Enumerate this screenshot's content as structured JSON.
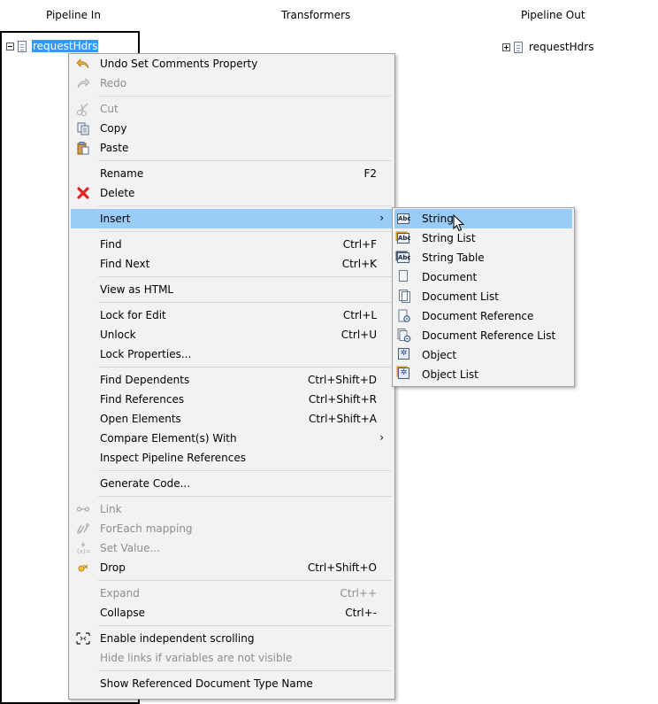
{
  "headers": {
    "pipeline_in": "Pipeline In",
    "transformers": "Transformers",
    "pipeline_out": "Pipeline Out"
  },
  "pipeline_in": {
    "node_label": "requestHdrs"
  },
  "pipeline_out": {
    "node_label": "requestHdrs"
  },
  "context_menu": {
    "undo": "Undo Set Comments Property",
    "redo": "Redo",
    "cut": "Cut",
    "copy": "Copy",
    "paste": "Paste",
    "rename": "Rename",
    "rename_shortcut": "F2",
    "delete": "Delete",
    "insert": "Insert",
    "find": "Find",
    "find_shortcut": "Ctrl+F",
    "find_next": "Find Next",
    "find_next_shortcut": "Ctrl+K",
    "view_as_html": "View as HTML",
    "lock_for_edit": "Lock for Edit",
    "lock_for_edit_shortcut": "Ctrl+L",
    "unlock": "Unlock",
    "unlock_shortcut": "Ctrl+U",
    "lock_properties": "Lock Properties...",
    "find_dependents": "Find Dependents",
    "find_dependents_shortcut": "Ctrl+Shift+D",
    "find_references": "Find References",
    "find_references_shortcut": "Ctrl+Shift+R",
    "open_elements": "Open Elements",
    "open_elements_shortcut": "Ctrl+Shift+A",
    "compare_elements": "Compare Element(s) With",
    "inspect_pipeline_refs": "Inspect Pipeline References",
    "generate_code": "Generate Code...",
    "link": "Link",
    "foreach_mapping": "ForEach mapping",
    "set_value": "Set Value...",
    "drop": "Drop",
    "drop_shortcut": "Ctrl+Shift+O",
    "expand": "Expand",
    "expand_shortcut": "Ctrl++",
    "collapse": "Collapse",
    "collapse_shortcut": "Ctrl+-",
    "enable_independent_scrolling": "Enable independent scrolling",
    "hide_links": "Hide links if variables are not visible",
    "show_referenced_doc": "Show Referenced Document Type Name",
    "submenu_arrow": "›"
  },
  "insert_submenu": {
    "string": "String",
    "string_list": "String List",
    "string_table": "String Table",
    "document": "Document",
    "document_list": "Document List",
    "document_reference": "Document Reference",
    "document_reference_list": "Document Reference List",
    "object": "Object",
    "object_list": "Object List",
    "abc_icon_text": "Abc"
  },
  "icons": {
    "undo": "undo-icon",
    "redo": "redo-icon",
    "cut": "scissors-icon",
    "copy": "copy-icon",
    "paste": "paste-icon",
    "delete": "red-x-icon",
    "link": "link-icon",
    "foreach": "foreach-icon",
    "set_value": "set-value-icon",
    "drop": "drop-icon",
    "scroll": "independent-scroll-icon"
  },
  "colors": {
    "selection": "#3399ff",
    "menu_highlight": "#99ccf7",
    "menu_bg": "#f2f2f2",
    "delete_red": "#e02424"
  }
}
